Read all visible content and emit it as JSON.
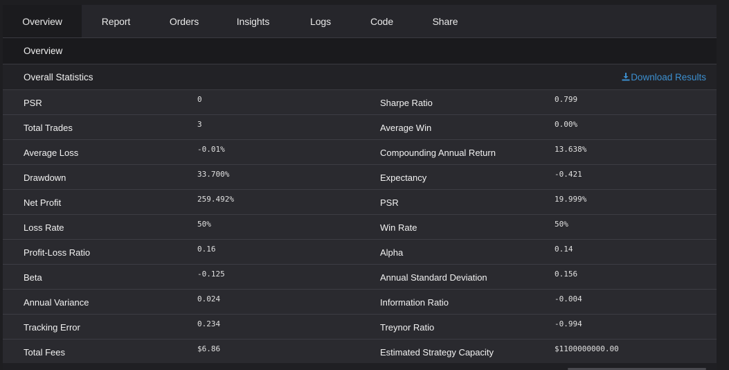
{
  "tabs": [
    {
      "label": "Overview"
    },
    {
      "label": "Report"
    },
    {
      "label": "Orders"
    },
    {
      "label": "Insights"
    },
    {
      "label": "Logs"
    },
    {
      "label": "Code"
    },
    {
      "label": "Share"
    }
  ],
  "section_title": "Overview",
  "stats": {
    "title": "Overall Statistics",
    "download_label": "Download Results",
    "download_icon": "download-icon",
    "rows": [
      {
        "l1": "PSR",
        "v1": "0",
        "l2": "Sharpe Ratio",
        "v2": "0.799"
      },
      {
        "l1": "Total Trades",
        "v1": "3",
        "l2": "Average Win",
        "v2": "0.00%"
      },
      {
        "l1": "Average Loss",
        "v1": "-0.01%",
        "l2": "Compounding Annual Return",
        "v2": "13.638%"
      },
      {
        "l1": "Drawdown",
        "v1": "33.700%",
        "l2": "Expectancy",
        "v2": "-0.421"
      },
      {
        "l1": "Net Profit",
        "v1": "259.492%",
        "l2": "PSR",
        "v2": "19.999%"
      },
      {
        "l1": "Loss Rate",
        "v1": "50%",
        "l2": "Win Rate",
        "v2": "50%"
      },
      {
        "l1": "Profit-Loss Ratio",
        "v1": "0.16",
        "l2": "Alpha",
        "v2": "0.14"
      },
      {
        "l1": "Beta",
        "v1": "-0.125",
        "l2": "Annual Standard Deviation",
        "v2": "0.156"
      },
      {
        "l1": "Annual Variance",
        "v1": "0.024",
        "l2": "Information Ratio",
        "v2": "-0.004"
      },
      {
        "l1": "Tracking Error",
        "v1": "0.234",
        "l2": "Treynor Ratio",
        "v2": "-0.994"
      },
      {
        "l1": "Total Fees",
        "v1": "$6.86",
        "l2": "Estimated Strategy Capacity",
        "v2": "$1100000000.00"
      }
    ]
  },
  "colors": {
    "accent": "#3c8fcf",
    "background": "#1e1e21",
    "panel": "#2a2a2f"
  }
}
